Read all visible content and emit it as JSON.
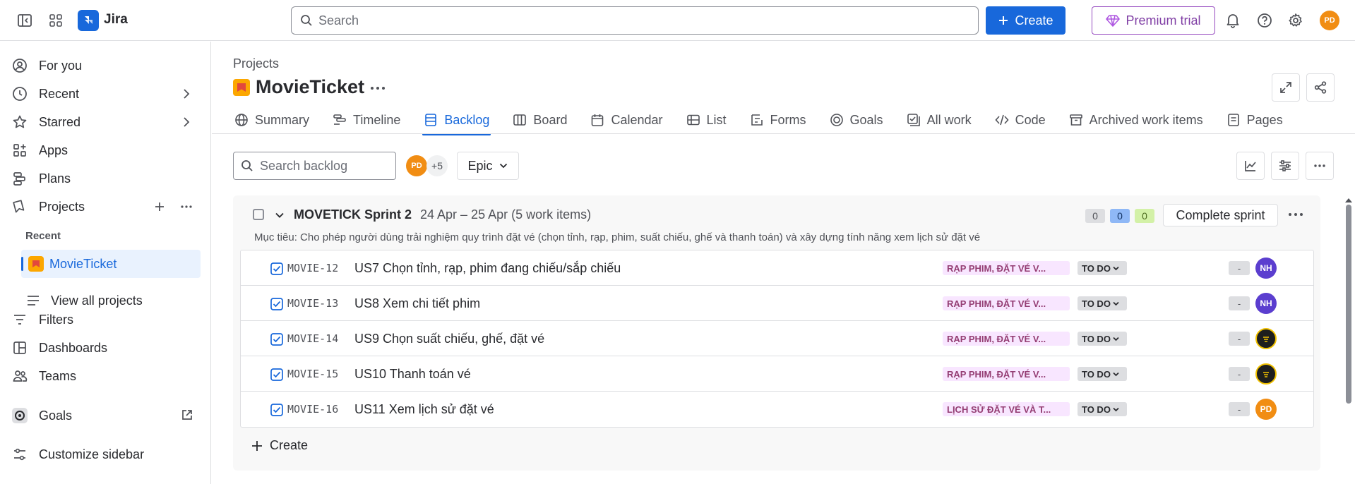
{
  "topbar": {
    "app_name": "Jira",
    "search_placeholder": "Search",
    "create_label": "Create",
    "premium_label": "Premium trial",
    "user_initials": "PD"
  },
  "sidebar": {
    "items": [
      {
        "label": "For you",
        "icon": "user-circle-icon"
      },
      {
        "label": "Recent",
        "icon": "clock-icon"
      },
      {
        "label": "Starred",
        "icon": "star-icon"
      },
      {
        "label": "Apps",
        "icon": "apps-icon"
      },
      {
        "label": "Plans",
        "icon": "plans-icon"
      },
      {
        "label": "Projects",
        "icon": "projects-icon"
      },
      {
        "label": "Filters",
        "icon": "filter-icon"
      },
      {
        "label": "Dashboards",
        "icon": "dashboard-icon"
      },
      {
        "label": "Teams",
        "icon": "teams-icon"
      },
      {
        "label": "Goals",
        "icon": "goals-icon"
      },
      {
        "label": "Customize sidebar",
        "icon": "customize-icon"
      }
    ],
    "recent_heading": "Recent",
    "recent_project": "MovieTicket",
    "view_all": "View all projects"
  },
  "main": {
    "breadcrumb": "Projects",
    "project_title": "MovieTicket",
    "tabs": [
      {
        "label": "Summary",
        "icon": "globe-icon"
      },
      {
        "label": "Timeline",
        "icon": "timeline-icon"
      },
      {
        "label": "Backlog",
        "icon": "backlog-icon",
        "active": true
      },
      {
        "label": "Board",
        "icon": "board-icon"
      },
      {
        "label": "Calendar",
        "icon": "calendar-icon"
      },
      {
        "label": "List",
        "icon": "list-icon"
      },
      {
        "label": "Forms",
        "icon": "forms-icon"
      },
      {
        "label": "Goals",
        "icon": "goal-icon"
      },
      {
        "label": "All work",
        "icon": "all-work-icon"
      },
      {
        "label": "Code",
        "icon": "code-icon"
      },
      {
        "label": "Archived work items",
        "icon": "archive-icon"
      },
      {
        "label": "Pages",
        "icon": "pages-icon"
      }
    ],
    "search_backlog_placeholder": "Search backlog",
    "assignee_initials": "PD",
    "assignee_more": "+5",
    "epic_label": "Epic"
  },
  "sprint": {
    "name": "MOVETICK Sprint 2",
    "dates": "24 Apr – 25 Apr (5 work items)",
    "goal": "Mục tiêu: Cho phép người dùng trải nghiệm quy trình đặt vé (chọn tỉnh, rạp, phim, suất chiếu, ghế và thanh toán) và xây dựng tính năng xem lịch sử đặt vé",
    "counts": {
      "todo": "0",
      "in_progress": "0",
      "done": "0"
    },
    "complete_label": "Complete sprint",
    "create_label": "Create",
    "colors": {
      "accent": "#1868DB",
      "epic_bg": "#F8E6FF",
      "epic_text": "#943D73"
    },
    "issues": [
      {
        "key": "MOVIE-12",
        "summary": "US7 Chọn tỉnh, rạp, phim đang chiếu/sắp chiếu",
        "epic": "RẠP PHIM, ĐẶT VÉ V...",
        "status": "TO DO",
        "estimate": "-",
        "assignee": "NH",
        "assignee_color": "#5B3ECF"
      },
      {
        "key": "MOVIE-13",
        "summary": "US8 Xem chi tiết phim",
        "epic": "RẠP PHIM, ĐẶT VÉ V...",
        "status": "TO DO",
        "estimate": "-",
        "assignee": "NH",
        "assignee_color": "#5B3ECF"
      },
      {
        "key": "MOVIE-14",
        "summary": "US9 Chọn suất chiếu, ghế, đặt vé",
        "epic": "RẠP PHIM, ĐẶT VÉ V...",
        "status": "TO DO",
        "estimate": "-",
        "assignee": "",
        "assignee_color": "#1E1E1E"
      },
      {
        "key": "MOVIE-15",
        "summary": "US10 Thanh toán vé",
        "epic": "RẠP PHIM, ĐẶT VÉ V...",
        "status": "TO DO",
        "estimate": "-",
        "assignee": "",
        "assignee_color": "#1E1E1E"
      },
      {
        "key": "MOVIE-16",
        "summary": "US11 Xem lịch sử đặt vé",
        "epic": "LỊCH SỬ ĐẶT VÉ VÀ T...",
        "status": "TO DO",
        "estimate": "-",
        "assignee": "PD",
        "assignee_color": "#F18D13"
      }
    ]
  }
}
